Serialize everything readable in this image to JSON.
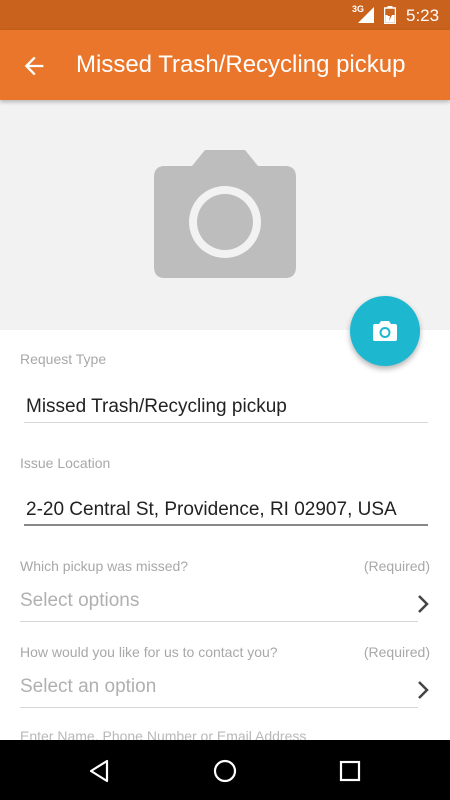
{
  "status_bar": {
    "network": "3G",
    "time": "5:23"
  },
  "app_bar": {
    "title": "Missed Trash/Recycling pickup",
    "back_icon": "arrow-left-icon"
  },
  "photo": {
    "placeholder_icon": "camera-icon",
    "fab_icon": "camera-icon"
  },
  "form": {
    "request_type": {
      "label": "Request Type",
      "value": "Missed Trash/Recycling pickup"
    },
    "issue_location": {
      "label": "Issue Location",
      "value": "2-20 Central St, Providence, RI 02907, USA"
    },
    "pickup_missed": {
      "label": "Which pickup was missed?",
      "required": "(Required)",
      "placeholder": "Select options"
    },
    "contact_method": {
      "label": "How would you like for us to contact you?",
      "required": "(Required)",
      "placeholder": "Select an option"
    },
    "contact_info": {
      "label": "Enter Name, Phone Number or Email Address"
    }
  },
  "colors": {
    "status_bar": "#c9621d",
    "app_bar": "#e9762a",
    "fab": "#1db8d0"
  }
}
